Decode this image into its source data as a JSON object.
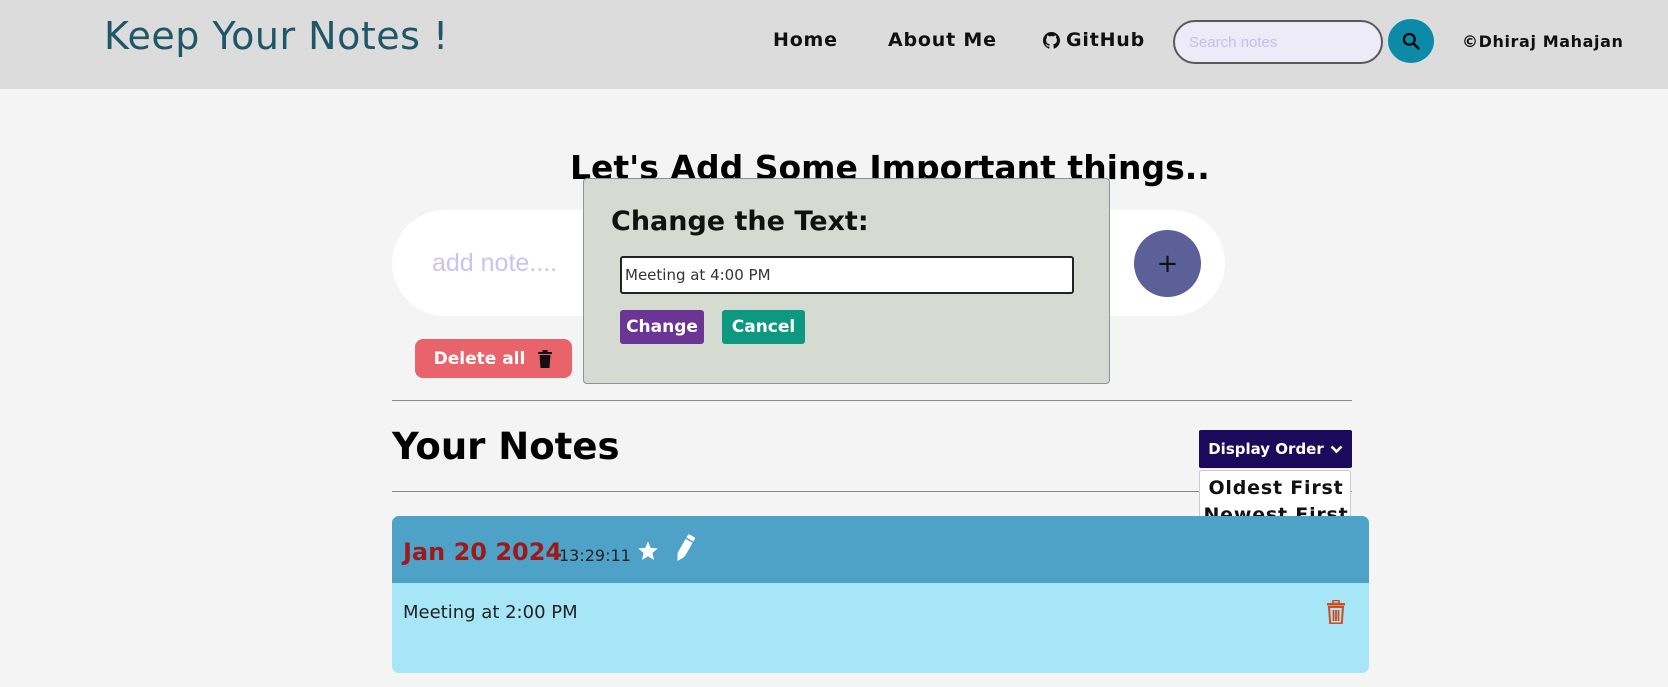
{
  "navbar": {
    "brand": "Keep Your Notes !",
    "links": [
      "Home",
      "About Me",
      "GitHub"
    ],
    "search_placeholder": "Search notes",
    "credit": "©Dhiraj Mahajan"
  },
  "main": {
    "heading": "Let's Add Some Important things..",
    "add_placeholder": "add note....",
    "add_button_label": "+",
    "delete_all_label": "Delete all",
    "notes_heading": "Your Notes"
  },
  "display_order": {
    "label": "Display Order",
    "options": [
      "Oldest First",
      "Newest First"
    ]
  },
  "notes": [
    {
      "date": "Jan 20 2024",
      "time": "13:29:11",
      "text": "Meeting at 2:00 PM"
    }
  ],
  "modal": {
    "title": "Change the Text:",
    "input_value": "Meeting at 4:00 PM",
    "change_label": "Change",
    "cancel_label": "Cancel"
  },
  "colors": {
    "navbar_bg": "#dcdcdc",
    "brand": "#1f5668",
    "add_button": "#5b6198",
    "delete_all": "#e8636a",
    "display_order": "#1b0a5c",
    "note_header": "#4fa2c7",
    "note_body": "#a7e6f6",
    "note_date": "#9c1a1a",
    "modal_bg": "#d5dbd0",
    "change_button": "#6a3595",
    "cancel_button": "#0d9981"
  }
}
